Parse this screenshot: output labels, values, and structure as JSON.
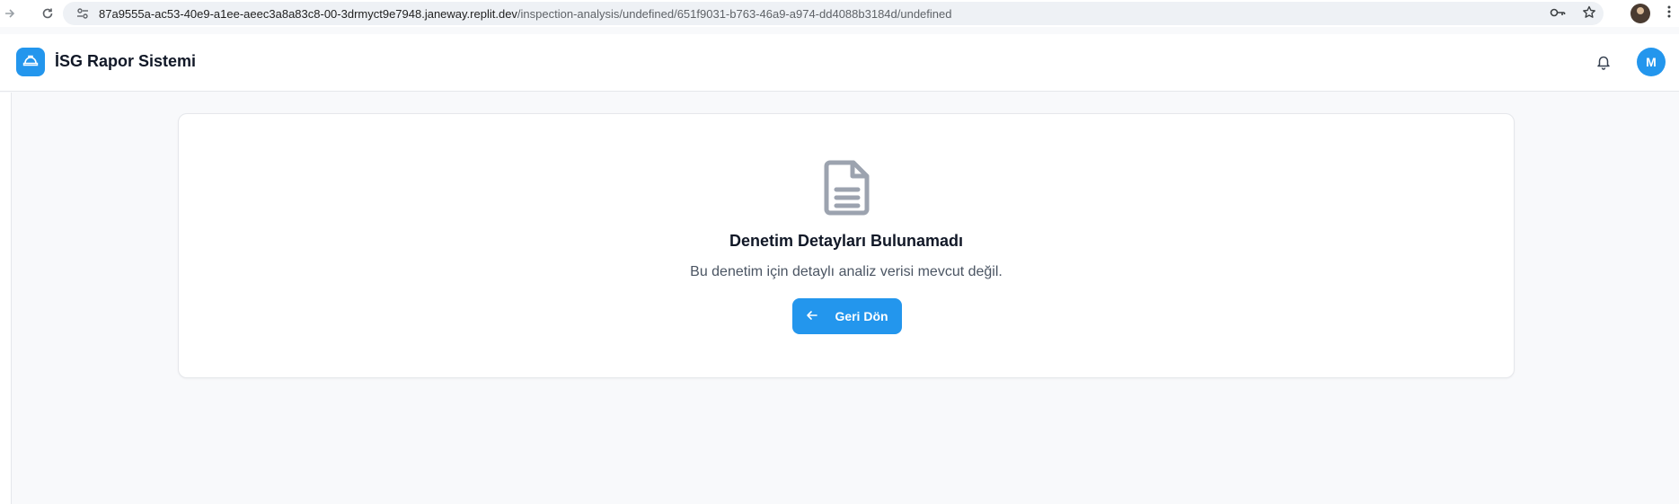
{
  "browser": {
    "url_host": "87a9555a-ac53-40e9-a1ee-aeec3a8a83c8-00-3drmyct9e7948.janeway.replit.dev",
    "url_path": "/inspection-analysis/undefined/651f9031-b763-46a9-a974-dd4088b3184d/undefined",
    "icons": [
      "forward-icon",
      "reload-icon",
      "site-info-icon",
      "password-key-icon",
      "bookmark-star-icon",
      "profile-avatar",
      "menu-dots-icon"
    ]
  },
  "header": {
    "title": "İSG Rapor Sistemi",
    "avatar_initial": "M",
    "icons": [
      "hard-hat-icon",
      "bell-icon"
    ]
  },
  "empty_state": {
    "title": "Denetim Detayları Bulunamadı",
    "description": "Bu denetim için detaylı analiz verisi mevcut değil.",
    "back_button_label": "Geri Dön",
    "icon": "document-icon"
  },
  "colors": {
    "accent": "#2396ed",
    "icon_gray": "#9ca3af",
    "page_bg": "#f8f9fb"
  }
}
